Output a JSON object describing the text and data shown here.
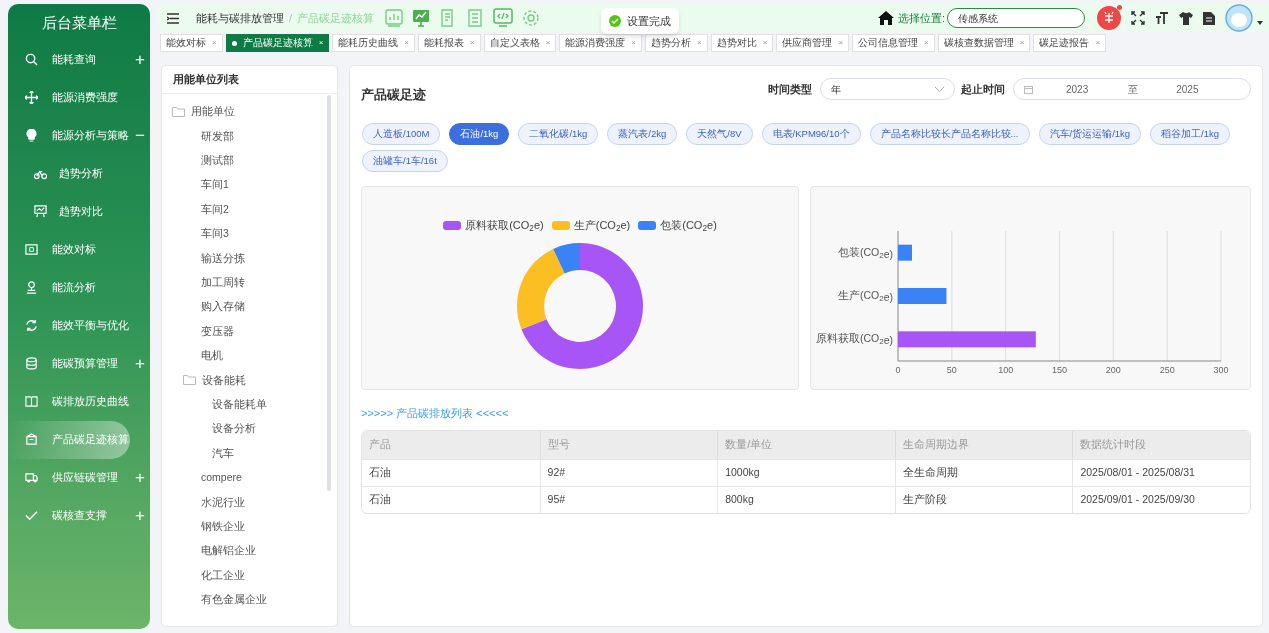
{
  "sidebar": {
    "title": "后台菜单栏",
    "items": [
      {
        "label": "能耗查询",
        "expander": "+",
        "selected": false
      },
      {
        "label": "能源消费强度",
        "selected": false
      },
      {
        "label": "能源分析与策略",
        "expander": "−",
        "selected": false,
        "children": [
          {
            "label": "趋势分析",
            "selected": false
          },
          {
            "label": "趋势对比",
            "selected": false
          }
        ]
      },
      {
        "label": "能效对标",
        "selected": false
      },
      {
        "label": "能流分析",
        "selected": false
      },
      {
        "label": "能效平衡与优化",
        "selected": false
      },
      {
        "label": "能碳预算管理",
        "expander": "+",
        "selected": false
      },
      {
        "label": "碳排放历史曲线",
        "selected": false
      },
      {
        "label": "产品碳足迹核算",
        "selected": true
      },
      {
        "label": "供应链碳管理",
        "expander": "+",
        "selected": false
      },
      {
        "label": "碳核查支撑",
        "expander": "+",
        "selected": false
      }
    ]
  },
  "header": {
    "breadcrumb": [
      "能耗与碳排放管理",
      "/",
      "产品碳足迹核算"
    ],
    "location_label": "选择位置:",
    "location_value": "传感系统",
    "toast": "设置完成"
  },
  "tabs": [
    {
      "label": "能效对标",
      "close": "×",
      "selected": false
    },
    {
      "label": "产品碳足迹核算",
      "close": "×",
      "selected": true
    },
    {
      "label": "能耗历史曲线",
      "close": "×",
      "selected": false
    },
    {
      "label": "能耗报表",
      "close": "×",
      "selected": false
    },
    {
      "label": "自定义表格",
      "close": "×",
      "selected": false
    },
    {
      "label": "能源消费强度",
      "close": "×",
      "selected": false
    },
    {
      "label": "趋势分析",
      "close": "×",
      "selected": false
    },
    {
      "label": "趋势对比",
      "close": "×",
      "selected": false
    },
    {
      "label": "供应商管理",
      "close": "×",
      "selected": false
    },
    {
      "label": "公司信息管理",
      "close": "×",
      "selected": false
    },
    {
      "label": "碳核查数据管理",
      "close": "×",
      "selected": false
    },
    {
      "label": "碳足迹报告",
      "close": "×",
      "selected": false
    }
  ],
  "unit_panel": {
    "title": "用能单位列表",
    "tree": [
      {
        "label": "用能单位",
        "folder": true,
        "children": [
          {
            "label": "研发部"
          },
          {
            "label": "测试部"
          },
          {
            "label": "车间1"
          },
          {
            "label": "车间2"
          },
          {
            "label": "车间3"
          },
          {
            "label": "输送分拣"
          },
          {
            "label": "加工周转"
          },
          {
            "label": "购入存储"
          },
          {
            "label": "变压器"
          },
          {
            "label": "电机"
          },
          {
            "label": "设备能耗",
            "folder": true,
            "children": [
              {
                "label": "设备能耗单"
              },
              {
                "label": "设备分析"
              },
              {
                "label": "汽车"
              }
            ]
          },
          {
            "label": "compere"
          },
          {
            "label": "水泥行业"
          },
          {
            "label": "钢铁企业"
          },
          {
            "label": "电解铝企业"
          },
          {
            "label": "化工企业"
          },
          {
            "label": "有色金属企业"
          }
        ]
      }
    ]
  },
  "footprint": {
    "title": "产品碳足迹",
    "time_type_label": "时间类型",
    "time_type": "年",
    "range_label": "起止时间",
    "range_start": "2023",
    "range_sep": "至",
    "range_end": "2025",
    "products": [
      {
        "label": "人造板/100M",
        "selected": false
      },
      {
        "label": "石油/1kg",
        "selected": true
      },
      {
        "label": "二氧化碳/1kg",
        "selected": false
      },
      {
        "label": "蒸汽表/2kg",
        "selected": false
      },
      {
        "label": "天然气/8V",
        "selected": false
      },
      {
        "label": "电表/KPM96/10个",
        "selected": false
      },
      {
        "label": "产品名称比较长产品名称比较...",
        "selected": false
      },
      {
        "label": "汽车/货运运输/1kg",
        "selected": false
      },
      {
        "label": "稻谷加工/1kg",
        "selected": false
      },
      {
        "label": "油罐车/1车/16t",
        "selected": false
      }
    ],
    "donut": {
      "legend": [
        {
          "label": "原料获取(CO$_{2}$e)",
          "color": "#a855f7"
        },
        {
          "label": "生产(CO$_{2}$e)",
          "color": "#fbbf24"
        },
        {
          "label": "包装(CO$_{2}$e)",
          "color": "#3b82f6"
        }
      ],
      "chart_data": {
        "type": "donut",
        "values": [
          69,
          24,
          7
        ]
      }
    },
    "bar": {
      "chart_data": {
        "type": "bar",
        "orientation": "horizontal",
        "categories": [
          "包装(CO$_{2}$e)",
          "生产(CO$_{2}$e)",
          "原料获取(CO$_{2}$e)"
        ],
        "xlim": [
          0,
          300
        ],
        "xticks": [
          0,
          50,
          100,
          150,
          200,
          250,
          300
        ],
        "stacked": true,
        "grid": true,
        "series": [
          {
            "color": "#3b82f6",
            "values": [
              13,
              45,
              null
            ]
          },
          {
            "color": "#a855f7",
            "values": [
              null,
              null,
              128
            ]
          }
        ]
      }
    },
    "list_title": ">>>>> 产品碳排放列表 <<<<<",
    "table": {
      "columns": [
        "产品",
        "型号",
        "数量/单位",
        "生命周期边界",
        "数据统计时段"
      ],
      "rows": [
        [
          "石油",
          "92#",
          "1000kg",
          "全生命周期",
          "2025/08/01 - 2025/08/31"
        ],
        [
          "石油",
          "95#",
          "800kg",
          "生产阶段",
          "2025/09/01 - 2025/09/30"
        ]
      ]
    }
  }
}
